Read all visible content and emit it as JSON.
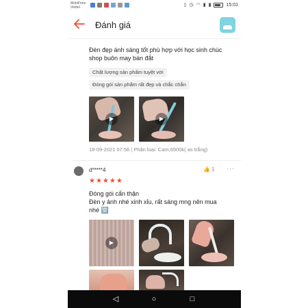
{
  "status_bar": {
    "carrier_1": "MobiFone",
    "carrier_2": "Viettel",
    "time": "15:01"
  },
  "header": {
    "title": "Đánh giá",
    "back_icon": "arrow-left-icon",
    "app_icon": "app-shortcut-icon",
    "accent_color": "#ee4d2d"
  },
  "review_1": {
    "text_line_1": "Đèn đẹp ánh sáng tốt phù hợp với học sinh chúc",
    "text_line_2": "shop buôn may bán đắt",
    "tags": [
      "Chất lượng sản phẩm tuyệt vời",
      "Đóng gói sản phẩm rất đẹp và chắc chắn"
    ],
    "meta": "18-09-2021 07:56 | Phân loại: Cam,6500k( as trắng)"
  },
  "review_2": {
    "username": "d*****4",
    "likes": "1",
    "more": "···",
    "stars": "★★★★★",
    "rating": 5,
    "text_line_1": "Đóng gói cẩn thận",
    "text_line_2": "Đèn y ảnh nhé xinh xỉu, rất sáng mng nên mua",
    "text_line_3": "nhé 🈳"
  },
  "nav_bar": {
    "back": "◁",
    "home": "○",
    "recents": "□"
  }
}
